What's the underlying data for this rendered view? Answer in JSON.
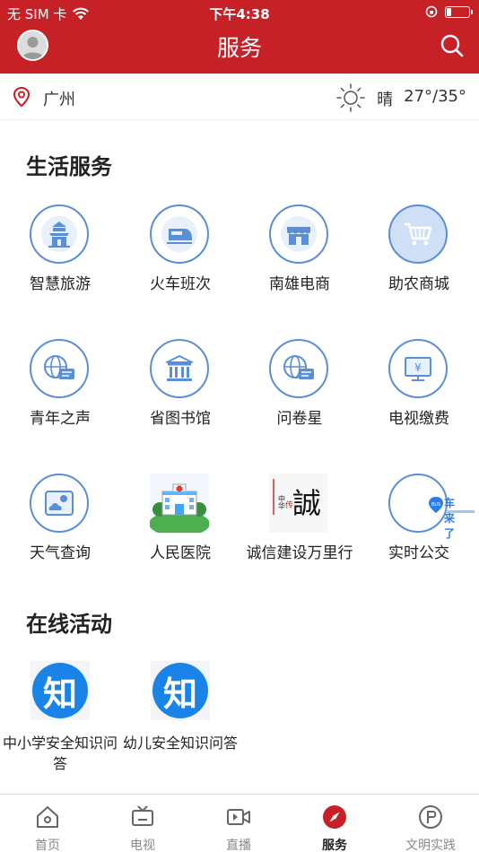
{
  "status_bar": {
    "carrier": "无 SIM 卡",
    "time": "下午4:38",
    "battery_level": 0.2
  },
  "header": {
    "title": "服务"
  },
  "location": {
    "city": "广州",
    "weather": "晴",
    "temperature": "27°/35°"
  },
  "sections": [
    {
      "title": "生活服务",
      "items": [
        {
          "label": "智慧旅游",
          "icon": "temple-icon"
        },
        {
          "label": "火车班次",
          "icon": "train-icon"
        },
        {
          "label": "南雄电商",
          "icon": "shop-icon"
        },
        {
          "label": "助农商城",
          "icon": "cart-icon"
        },
        {
          "label": "青年之声",
          "icon": "globe-chat-icon"
        },
        {
          "label": "省图书馆",
          "icon": "library-icon"
        },
        {
          "label": "问卷星",
          "icon": "globe-chat-icon"
        },
        {
          "label": "电视缴费",
          "icon": "tv-yuan-icon"
        },
        {
          "label": "天气查询",
          "icon": "weather-icon"
        },
        {
          "label": "人民医院",
          "icon": "hospital-icon"
        },
        {
          "label": "诚信建设万里行",
          "icon": "integrity-calligraphy-icon",
          "icon_text": "誠"
        },
        {
          "label": "实时公交",
          "icon": "bus-app-icon",
          "icon_text": "车来了"
        }
      ]
    },
    {
      "title": "在线活动",
      "items": [
        {
          "label": "中小学安全知识问答",
          "icon": "zhihu-icon",
          "icon_text": "知"
        },
        {
          "label": "幼儿安全知识问答",
          "icon": "zhihu-icon",
          "icon_text": "知"
        }
      ]
    }
  ],
  "tabs": [
    {
      "label": "首页",
      "icon": "home-icon"
    },
    {
      "label": "电视",
      "icon": "tv-icon"
    },
    {
      "label": "直播",
      "icon": "live-video-icon"
    },
    {
      "label": "服务",
      "icon": "compass-icon",
      "active": true
    },
    {
      "label": "文明实践",
      "icon": "civilization-icon"
    }
  ],
  "colors": {
    "brand": "#c62127",
    "icon_blue": "#5a8fd8",
    "zhihu_blue": "#1a83e8"
  }
}
